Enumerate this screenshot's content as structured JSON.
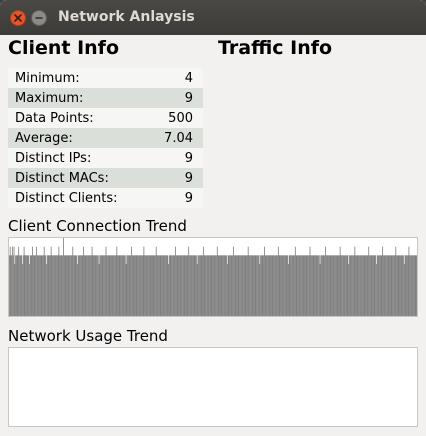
{
  "window": {
    "title": "Network Anlaysis"
  },
  "client_info": {
    "heading": "Client Info",
    "rows": [
      {
        "label": "Minimum:",
        "value": "4"
      },
      {
        "label": "Maximum:",
        "value": "9"
      },
      {
        "label": "Data Points:",
        "value": "500"
      },
      {
        "label": "Average:",
        "value": "7.04"
      },
      {
        "label": "Distinct IPs:",
        "value": "9"
      },
      {
        "label": "Distinct MACs:",
        "value": "9"
      },
      {
        "label": "Distinct Clients:",
        "value": "9"
      }
    ]
  },
  "traffic_info": {
    "heading": "Traffic Info"
  },
  "client_trend": {
    "label": "Client Connection Trend",
    "bar_color": "#7f7f7f"
  },
  "network_trend": {
    "label": "Network Usage Trend"
  },
  "chart_data": {
    "type": "bar",
    "ylim": [
      0,
      9
    ],
    "values": [
      7,
      8,
      7,
      7,
      8,
      7,
      8,
      6,
      7,
      7,
      7,
      7,
      8,
      7,
      7,
      7,
      7,
      6,
      7,
      8,
      7,
      7,
      7,
      7,
      7,
      7,
      6,
      7,
      7,
      7,
      8,
      7,
      7,
      7,
      7,
      8,
      7,
      7,
      7,
      7,
      7,
      7,
      7,
      7,
      7,
      8,
      7,
      7,
      6,
      7,
      7,
      7,
      7,
      7,
      8,
      7,
      7,
      7,
      7,
      7,
      7,
      7,
      7,
      7,
      8,
      7,
      7,
      7,
      7,
      7,
      9,
      7,
      7,
      7,
      7,
      7,
      7,
      7,
      7,
      7,
      7,
      7,
      8,
      7,
      7,
      7,
      7,
      7,
      6,
      7,
      7,
      7,
      7,
      7,
      7,
      7,
      8,
      7,
      7,
      7,
      7,
      7,
      7,
      7,
      7,
      7,
      7,
      8,
      7,
      7,
      7,
      7,
      7,
      7,
      7,
      7,
      6,
      7,
      7,
      7,
      7,
      7,
      7,
      7,
      7,
      8,
      7,
      7,
      7,
      7,
      7,
      7,
      7,
      7,
      7,
      7,
      7,
      7,
      7,
      8,
      7,
      7,
      7,
      7,
      7,
      7,
      7,
      7,
      7,
      7,
      7,
      6,
      7,
      7,
      7,
      7,
      7,
      7,
      8,
      7,
      7,
      7,
      7,
      7,
      7,
      7,
      7,
      7,
      7,
      7,
      7,
      7,
      7,
      7,
      8,
      7,
      7,
      7,
      7,
      7,
      7,
      7,
      7,
      7,
      7,
      7,
      7,
      7,
      7,
      7,
      8,
      7,
      7,
      7,
      7,
      7,
      7,
      7,
      7,
      7,
      7,
      7,
      7,
      7,
      7,
      7,
      6,
      7,
      7,
      7,
      7,
      7,
      7,
      7,
      7,
      8,
      7,
      7,
      7,
      7,
      7,
      7,
      7,
      7,
      7,
      7,
      7,
      7,
      7,
      7,
      7,
      7,
      8,
      7,
      7,
      7,
      7,
      7,
      7,
      7,
      7,
      7,
      7,
      6,
      7,
      7,
      7,
      7,
      7,
      7,
      7,
      8,
      7,
      7,
      7,
      7,
      7,
      7,
      7,
      7,
      7,
      7,
      7,
      7,
      7,
      7,
      7,
      7,
      7,
      8,
      7,
      7,
      7,
      7,
      7,
      7,
      7,
      7,
      7,
      7,
      7,
      7,
      6,
      7,
      7,
      7,
      7,
      7,
      7,
      7,
      8,
      7,
      7,
      7,
      7,
      7,
      7,
      7,
      7,
      7,
      7,
      7,
      7,
      7,
      7,
      7,
      7,
      7,
      7,
      8,
      7,
      7,
      7,
      7,
      7,
      7,
      7,
      7,
      7,
      7,
      7,
      7,
      7,
      7,
      6,
      7,
      7,
      7,
      7,
      7,
      8,
      7,
      7,
      7,
      7,
      7,
      7,
      7,
      7,
      7,
      7,
      7,
      7,
      7,
      7,
      7,
      7,
      7,
      8,
      7,
      7,
      7,
      7,
      7,
      7,
      7,
      7,
      7,
      7,
      7,
      7,
      6,
      7,
      7,
      7,
      7,
      7,
      7,
      7,
      7,
      8,
      7,
      7,
      7,
      7,
      7,
      7,
      7,
      7,
      7,
      7,
      7,
      7,
      7,
      7,
      7,
      7,
      7,
      7,
      8,
      7,
      7,
      7,
      7,
      7,
      7,
      7,
      7,
      7,
      7,
      7,
      7,
      6,
      7,
      7,
      7,
      7,
      7,
      7,
      8,
      7,
      7,
      7,
      7,
      7,
      7,
      7,
      7,
      7,
      7,
      7,
      7,
      7,
      7,
      7,
      7,
      7,
      7,
      8,
      7,
      7,
      7,
      7,
      7,
      7,
      7,
      7,
      7,
      7,
      6,
      7,
      7,
      7,
      7,
      7,
      7,
      7,
      8,
      7,
      7,
      7,
      7,
      7,
      7,
      7,
      7,
      7,
      7,
      7,
      7,
      7,
      7,
      7,
      7,
      7,
      8,
      7,
      7,
      7,
      7,
      7,
      7,
      7,
      7,
      7,
      6,
      7,
      7,
      7,
      7,
      7,
      7,
      7,
      8,
      7,
      7,
      7,
      7,
      7,
      7,
      7,
      7,
      7,
      7,
      7,
      7,
      7,
      7,
      7,
      7,
      8,
      7,
      7,
      7,
      7,
      7,
      7,
      7,
      7,
      7,
      7,
      6,
      7,
      7,
      7,
      7,
      7,
      8,
      7,
      7,
      7,
      7,
      7,
      7,
      7,
      7,
      7,
      7
    ]
  }
}
